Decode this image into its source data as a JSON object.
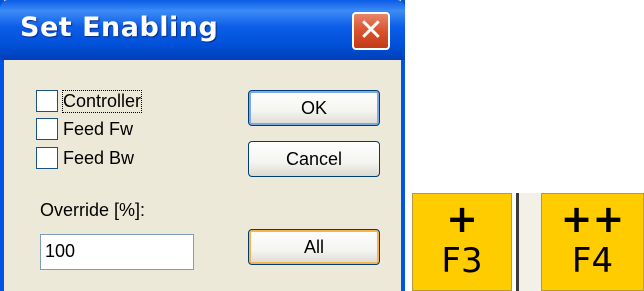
{
  "dialog": {
    "title": "Set Enabling",
    "close_glyph": "✕",
    "checkboxes": [
      {
        "label": "Controller",
        "checked": false,
        "focused": true
      },
      {
        "label": "Feed Fw",
        "checked": false,
        "focused": false
      },
      {
        "label": "Feed Bw",
        "checked": false,
        "focused": false
      }
    ],
    "buttons": {
      "ok": "OK",
      "cancel": "Cancel",
      "all": "All"
    },
    "override": {
      "label": "Override [%]:",
      "value": "100"
    }
  },
  "function_keys": [
    {
      "symbol": "+",
      "key": "F3"
    },
    {
      "symbol": "++",
      "key": "F4"
    }
  ],
  "colors": {
    "titlebar": "#0054e3",
    "dialog_bg": "#ece9d8",
    "close_button": "#d9532c",
    "function_key_bg": "#ffcc00"
  },
  "icons": {
    "close": "close-icon"
  }
}
